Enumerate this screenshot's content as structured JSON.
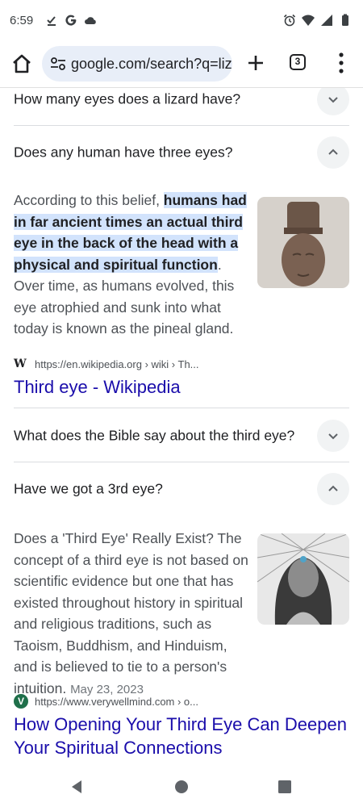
{
  "status_bar": {
    "time": "6:59",
    "left_icons": [
      "download-done-icon",
      "google-icon",
      "cloud-icon"
    ],
    "right_icons": [
      "alarm-icon",
      "wifi-icon",
      "signal-icon",
      "battery-icon"
    ]
  },
  "toolbar": {
    "url": "google.com/search?q=liz",
    "tab_count": "3"
  },
  "faq": [
    {
      "question": "How many eyes does a lizard have?",
      "expanded": false
    },
    {
      "question": "Does any human have three eyes?",
      "expanded": true,
      "answer_prefix": "According to this belief, ",
      "answer_highlight": "humans had in far ancient times an actual third eye in the back of the head with a physical and spiritual function",
      "answer_suffix": ". Over time, as humans evolved, this eye atrophied and sunk into what today is known as the pineal gland.",
      "source_icon": "W",
      "source_url": "https://en.wikipedia.org › wiki › Th...",
      "source_title": "Third eye - Wikipedia"
    },
    {
      "question": "What does the Bible say about the third eye?",
      "expanded": false
    },
    {
      "question": "Have we got a 3rd eye?",
      "expanded": true,
      "answer_text": "Does a 'Third Eye' Really Exist? The concept of a third eye is not based on scientific evidence but one that has existed throughout history in spiritual and religious traditions, such as Taoism, Buddhism, and Hinduism, and is believed to tie to a person's intuition.",
      "answer_date": "May 23, 2023",
      "source_icon": "V",
      "source_url": "https://www.verywellmind.com › o...",
      "source_title": "How Opening Your Third Eye Can Deepen Your Spiritual Connections"
    }
  ],
  "nav": {
    "buttons": [
      "back-icon",
      "home-circle-icon",
      "recents-icon"
    ]
  },
  "colors": {
    "link": "#1a0dab",
    "highlight": "#d2e3fc",
    "url_pill": "#e8eef8"
  }
}
